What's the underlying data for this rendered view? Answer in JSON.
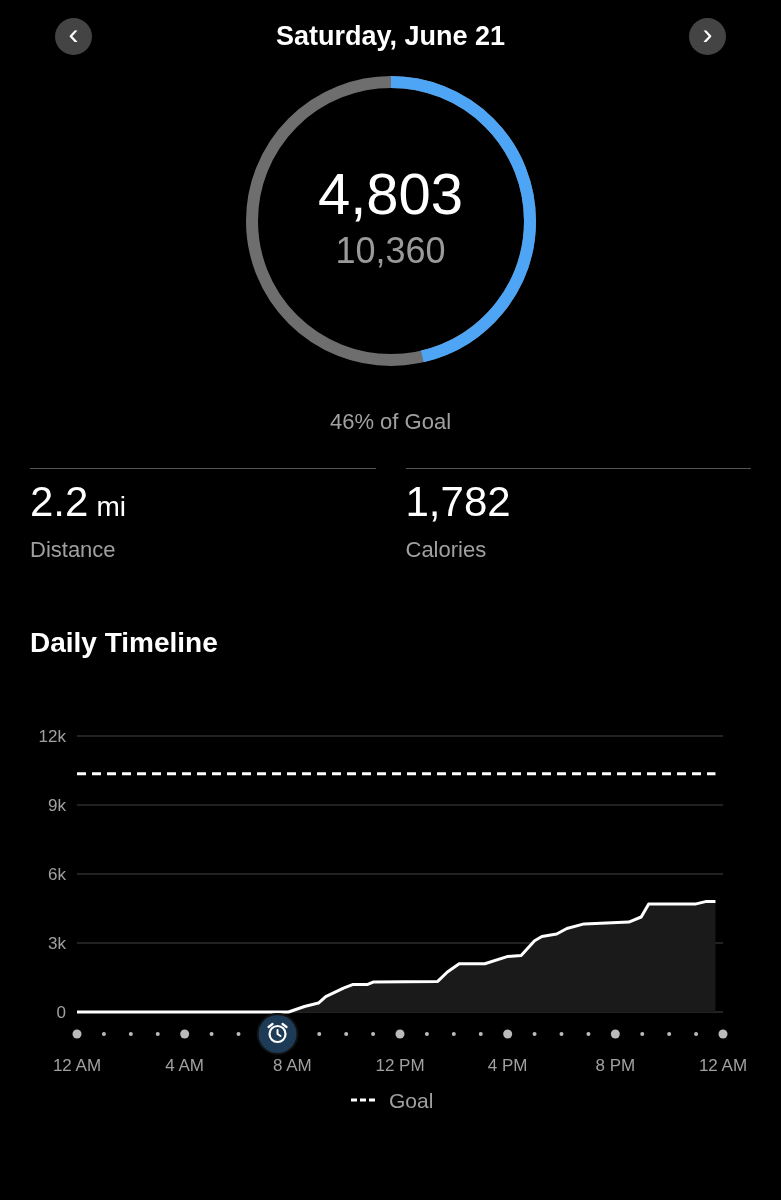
{
  "header": {
    "prev_button": "‹",
    "date": "Saturday, June 21",
    "next_button": "›"
  },
  "ring": {
    "steps": "4,803",
    "goal": "10,360",
    "caption": "46% of Goal"
  },
  "stats": [
    {
      "value": "2.2",
      "unit": "mi",
      "label": "Distance"
    },
    {
      "value": "1,782",
      "label": "Calories"
    }
  ],
  "timeline": {
    "title": "Daily Timeline",
    "chart_data": {
      "type": "area",
      "x": [
        0,
        7.86,
        8.45,
        8.97,
        9.24,
        9.9,
        10.26,
        10.8,
        11,
        13.4,
        13.76,
        14.2,
        15.15,
        15.98,
        16.5,
        17,
        17.27,
        17.82,
        18.2,
        18.84,
        20.5,
        20.96,
        21.24,
        23,
        23.35,
        23.72
      ],
      "series": [
        {
          "color": "#ffffff",
          "values": [
            0,
            0,
            240,
            390,
            670,
            1040,
            1200,
            1200,
            1300,
            1330,
            1740,
            2100,
            2100,
            2410,
            2460,
            3100,
            3280,
            3390,
            3630,
            3830,
            3910,
            4130,
            4700,
            4700,
            4800,
            4800
          ]
        },
        {
          "name": "Goal",
          "type": "line",
          "line_style": "dashed",
          "color": "#ffffff",
          "values": [
            10360,
            10360,
            10360,
            10360,
            10360,
            10360,
            10360,
            10360,
            10360,
            10360,
            10360,
            10360,
            10360,
            10360,
            10360,
            10360,
            10360,
            10360,
            10360,
            10360,
            10360,
            10360,
            10360,
            10360,
            10360,
            10360
          ]
        }
      ],
      "xlim": [
        0,
        24
      ],
      "ylim": [
        0,
        12000
      ],
      "grid": true,
      "xticks": [
        {
          "value": 4,
          "label": "4 AM"
        },
        {
          "value": 8,
          "label": "8 AM"
        },
        {
          "value": 12,
          "label": "12 PM"
        }
      ],
      "yticks": [
        {
          "value": 0,
          "label": "0"
        },
        {
          "value": 3000,
          "label": "3k"
        },
        {
          "value": 6000,
          "label": "6k"
        },
        {
          "value": 9000,
          "label": "9k"
        },
        {
          "value": 12000,
          "label": "12k"
        }
      ]
    },
    "other_time_labels": [
      "12 AM",
      "4 PM",
      "8 PM",
      "12 AM"
    ]
  }
}
